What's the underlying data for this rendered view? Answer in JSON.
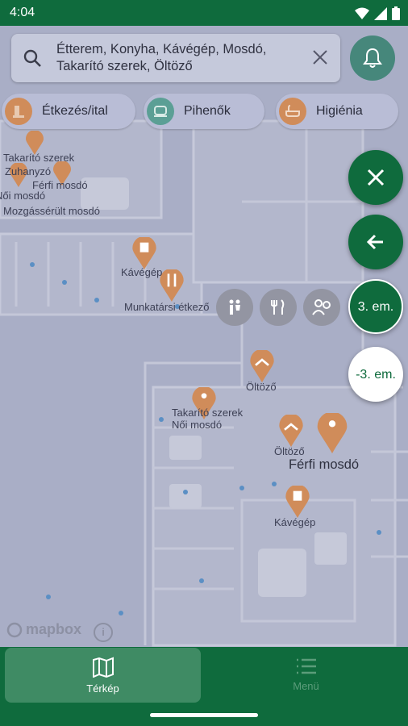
{
  "status": {
    "time": "4:04"
  },
  "search": {
    "query": "Étterem, Konyha, Kávégép, Mosdó, Takarító szerek, Öltöző"
  },
  "chips": [
    {
      "label": "Étkezés/ital",
      "icon": "fork-knife-icon"
    },
    {
      "label": "Pihenők",
      "icon": "armchair-icon"
    },
    {
      "label": "Higiénia",
      "icon": "bathtub-icon"
    }
  ],
  "floors": {
    "current": "3. em.",
    "other": "-3. em."
  },
  "map_labels": {
    "takarito1": "Takarító szerek",
    "zuhanyzo": "Zuhanyzó",
    "noi_mosdo1": "Női mosdó",
    "ferfi_mosdo1": "Férfi mosdó",
    "mozgasserult": "Mozgássérült mosdó",
    "kavegep1": "Kávégép",
    "munkatarsi": "Munkatársi étkező",
    "oltozo1": "Öltöző",
    "takarito2": "Takarító szerek",
    "noi_mosdo2": "Női mosdó",
    "oltozo2": "Öltöző",
    "ferfi_mosdo2": "Férfi mosdó",
    "kavegep2": "Kávégép"
  },
  "attribution": {
    "logo": "mapbox",
    "info": "i"
  },
  "nav": {
    "map_label": "Térkép",
    "menu_label": "Menü"
  },
  "colors": {
    "brand": "#0f6b3d",
    "poi": "#d08c5a",
    "overlay": "#a9aec6"
  }
}
